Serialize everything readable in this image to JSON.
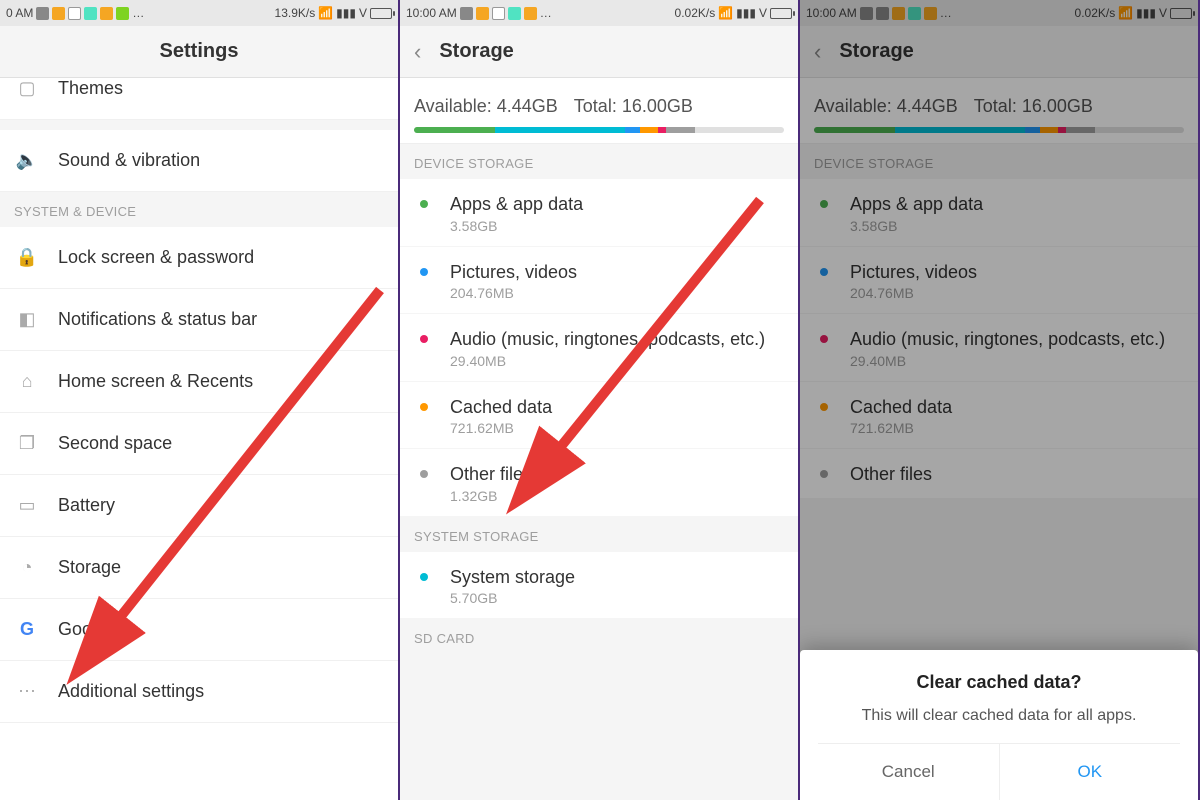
{
  "panels": [
    {
      "status": {
        "time": "0 AM",
        "speed": "13.9K/s",
        "signal": "V"
      },
      "header": {
        "title": "Settings"
      },
      "top_cut": "Themes",
      "rows": [
        {
          "icon": "speaker",
          "label": "Sound & vibration"
        }
      ],
      "section1": "SYSTEM & DEVICE",
      "sys_rows": [
        {
          "icon": "lock",
          "label": "Lock screen & password"
        },
        {
          "icon": "notif",
          "label": "Notifications & status bar"
        },
        {
          "icon": "home",
          "label": "Home screen & Recents"
        },
        {
          "icon": "copy",
          "label": "Second space"
        },
        {
          "icon": "battery",
          "label": "Battery"
        },
        {
          "icon": "pie",
          "label": "Storage"
        },
        {
          "icon": "google",
          "label": "Google"
        },
        {
          "icon": "dots",
          "label": "Additional settings"
        }
      ]
    },
    {
      "status": {
        "time": "10:00 AM",
        "speed": "0.02K/s",
        "signal": "V"
      },
      "header": {
        "title": "Storage"
      },
      "summary": {
        "available_label": "Available:",
        "available_value": "4.44GB",
        "total_label": "Total:",
        "total_value": "16.00GB"
      },
      "section_device": "DEVICE STORAGE",
      "device_rows": [
        {
          "color": "#4caf50",
          "title": "Apps & app data",
          "sub": "3.58GB"
        },
        {
          "color": "#2196f3",
          "title": "Pictures, videos",
          "sub": "204.76MB"
        },
        {
          "color": "#e91e63",
          "title": "Audio (music, ringtones, podcasts, etc.)",
          "sub": "29.40MB"
        },
        {
          "color": "#ff9800",
          "title": "Cached data",
          "sub": "721.62MB"
        },
        {
          "color": "#9e9e9e",
          "title": "Other files",
          "sub": "1.32GB"
        }
      ],
      "section_system": "SYSTEM STORAGE",
      "system_rows": [
        {
          "color": "#00bcd4",
          "title": "System storage",
          "sub": "5.70GB"
        }
      ],
      "section_sd": "SD CARD"
    },
    {
      "status": {
        "time": "10:00 AM",
        "speed": "0.02K/s",
        "signal": "V"
      },
      "header": {
        "title": "Storage"
      },
      "summary": {
        "available_label": "Available:",
        "available_value": "4.44GB",
        "total_label": "Total:",
        "total_value": "16.00GB"
      },
      "section_device": "DEVICE STORAGE",
      "device_rows": [
        {
          "color": "#4caf50",
          "title": "Apps & app data",
          "sub": "3.58GB"
        },
        {
          "color": "#2196f3",
          "title": "Pictures, videos",
          "sub": "204.76MB"
        },
        {
          "color": "#e91e63",
          "title": "Audio (music, ringtones, podcasts, etc.)",
          "sub": "29.40MB"
        },
        {
          "color": "#ff9800",
          "title": "Cached data",
          "sub": "721.62MB"
        },
        {
          "color": "#9e9e9e",
          "title": "Other files",
          "sub": ""
        }
      ],
      "dialog": {
        "title": "Clear cached data?",
        "message": "This will clear cached data for all apps.",
        "cancel": "Cancel",
        "ok": "OK"
      }
    }
  ],
  "bar_segments": [
    {
      "color": "#4caf50",
      "pct": 22
    },
    {
      "color": "#00bcd4",
      "pct": 35
    },
    {
      "color": "#2196f3",
      "pct": 4
    },
    {
      "color": "#ff9800",
      "pct": 5
    },
    {
      "color": "#e91e63",
      "pct": 2
    },
    {
      "color": "#9e9e9e",
      "pct": 8
    }
  ]
}
